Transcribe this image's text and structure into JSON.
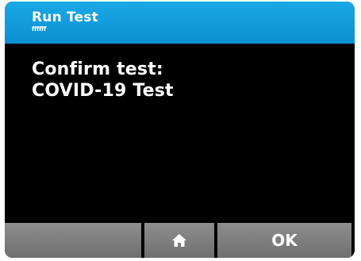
{
  "header": {
    "title": "Run Test",
    "subtitle": "ffffff"
  },
  "message": {
    "line1": "Confirm test:",
    "line2": "COVID-19 Test"
  },
  "softkeys": {
    "left_label": "",
    "home_icon": "home-icon",
    "ok_label": "OK"
  },
  "colors": {
    "titlebar": "#0c8fd2",
    "screen_background": "#000000",
    "softkey": "#7d7d7d",
    "text": "#ffffff"
  }
}
